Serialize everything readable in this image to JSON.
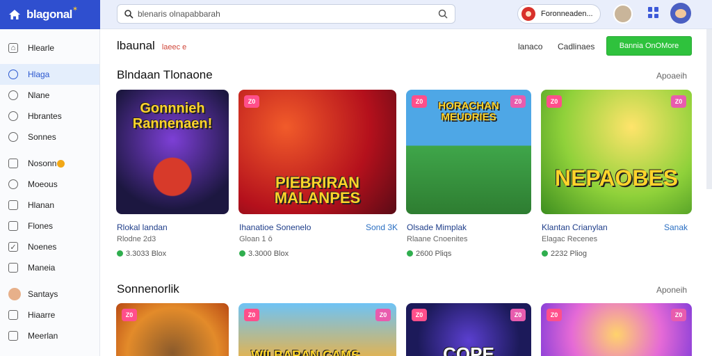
{
  "logo": {
    "text": "blagonal"
  },
  "search": {
    "placeholder": "blenaris olnapabbarah"
  },
  "account": {
    "label": "Foronneaden..."
  },
  "sidebar": {
    "items": [
      {
        "label": "Hlearle",
        "icon": "home-icon"
      },
      {
        "label": "Hlaga",
        "icon": "chat-icon",
        "active": true
      },
      {
        "label": "Nlane",
        "icon": "tag-icon"
      },
      {
        "label": "Hbrantes",
        "icon": "compass-icon"
      },
      {
        "label": "Sonnes",
        "icon": "star-icon"
      },
      {
        "label": "Nosonn",
        "icon": "box-icon"
      },
      {
        "label": "Moeous",
        "icon": "clock-icon"
      },
      {
        "label": "Hlanan",
        "icon": "folder-icon"
      },
      {
        "label": "Flones",
        "icon": "doc-icon"
      },
      {
        "label": "Noenes",
        "icon": "check-icon"
      },
      {
        "label": "Maneia",
        "icon": "mail-icon"
      },
      {
        "label": "Santays",
        "icon": "person-icon"
      },
      {
        "label": "Hiaarre",
        "icon": "doc-icon"
      },
      {
        "label": "Meerlan",
        "icon": "photo-icon"
      }
    ]
  },
  "header": {
    "title": "lbaunal",
    "subtitle": "laeec e",
    "link1": "lanaco",
    "link2": "Cadlinaes",
    "cta": "Bannia OnOMore"
  },
  "sections": [
    {
      "title": "Blndaan Tlonaone",
      "see_all": "Apoaeih"
    },
    {
      "title": "Sonnenorlik",
      "see_all": "Aponeih"
    }
  ],
  "cards_row1": [
    {
      "art": "Gonnnieh Rannenaen!",
      "title": "Rlokal landan",
      "subtitle": "Rlodne 2d3",
      "rating": "3.3033 Blox",
      "price": ""
    },
    {
      "art": "PIEBRIRAN MALANPES",
      "title": "Ihanatioe Sonenelo",
      "subtitle": "Gloan 1 ō",
      "rating": "3.3000 Blox",
      "price": "Sond 3K",
      "badge_l": "Z0"
    },
    {
      "art": "HORACHAN MEUDRIES",
      "title": "Olsade Mimplak",
      "subtitle": "Rlaane Cnoenites",
      "rating": "2600 Pliqs",
      "price": "",
      "badge_l": "Z0",
      "badge_r": "Z0"
    },
    {
      "art": "NEPAOBES",
      "title": "Klantan Crianylan",
      "subtitle": "Elagac Recenes",
      "rating": "2232 Pliog",
      "price": "Sanak",
      "badge_l": "Z0",
      "badge_r": "Z0"
    }
  ],
  "cards_row2": [
    {
      "art": "",
      "badge_l": "Z0"
    },
    {
      "art": "WILBARAN CAMS",
      "badge_l": "Z0",
      "badge_r": "Z0"
    },
    {
      "art": "COPE",
      "badge_l": "Z0",
      "badge_r": "Z0"
    },
    {
      "art": "",
      "badge_l": "Z0",
      "badge_r": "Z0"
    }
  ],
  "colors": {
    "accent": "#2f4fcf",
    "cta": "#2fc23d",
    "sidebar_active": "#e4eefc"
  }
}
